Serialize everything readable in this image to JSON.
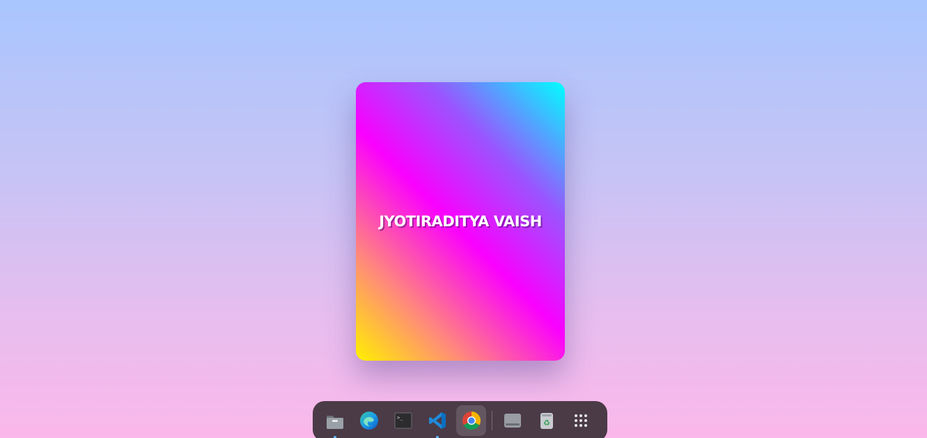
{
  "card": {
    "title": "JYOTIRADITYA VAISH"
  },
  "dock": {
    "items": [
      {
        "icon": "file-manager-icon",
        "running": true
      },
      {
        "icon": "edge-browser-icon",
        "running": false
      },
      {
        "icon": "terminal-icon",
        "running": false
      },
      {
        "icon": "vscode-icon",
        "running": true
      },
      {
        "icon": "chrome-browser-icon",
        "running": false,
        "active": true
      },
      {
        "icon": "drive-icon",
        "running": false
      },
      {
        "icon": "recycle-bin-icon",
        "running": false
      },
      {
        "icon": "app-grid-icon",
        "running": false
      }
    ]
  },
  "colors": {
    "dock_background": "#4b3b47",
    "running_indicator": "#5fb3ff",
    "card_gradient": [
      "#fff000",
      "#ff8a7a",
      "#fa00ff",
      "#9a55ff",
      "#00ffff"
    ]
  }
}
